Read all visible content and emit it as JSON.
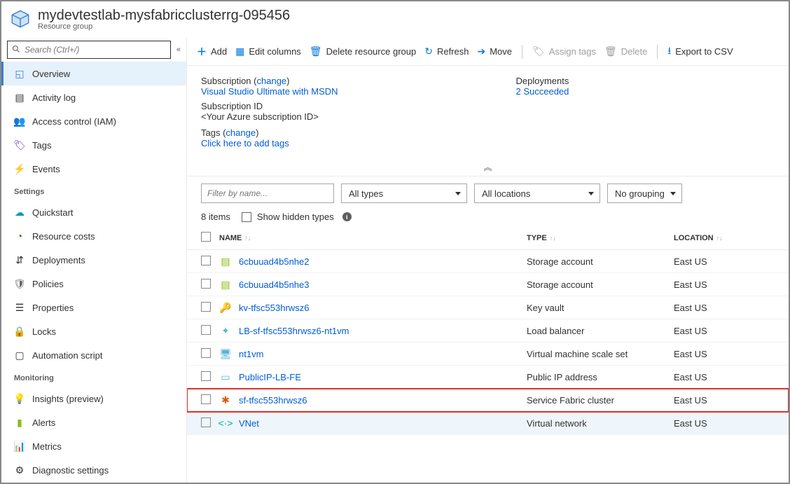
{
  "header": {
    "title": "mydevtestlab-mysfabricclusterrg-095456",
    "subtitle": "Resource group"
  },
  "sidebar": {
    "search_placeholder": "Search (Ctrl+/)",
    "items": [
      {
        "label": "Overview",
        "icon": "cube-icon",
        "color": "#3b7dd8",
        "selected": true
      },
      {
        "label": "Activity log",
        "icon": "log-icon",
        "color": "#323130"
      },
      {
        "label": "Access control (IAM)",
        "icon": "people-icon",
        "color": "#015cda"
      },
      {
        "label": "Tags",
        "icon": "tag-icon",
        "color": "#6b2fbf"
      },
      {
        "label": "Events",
        "icon": "bolt-icon",
        "color": "#faa21b"
      }
    ],
    "sections": [
      {
        "title": "Settings",
        "items": [
          {
            "label": "Quickstart",
            "icon": "rocket-icon",
            "color": "#0099bc"
          },
          {
            "label": "Resource costs",
            "icon": "cost-icon",
            "color": "#107c10"
          },
          {
            "label": "Deployments",
            "icon": "deploy-icon",
            "color": "#323130"
          },
          {
            "label": "Policies",
            "icon": "policy-icon",
            "color": "#666"
          },
          {
            "label": "Properties",
            "icon": "properties-icon",
            "color": "#323130"
          },
          {
            "label": "Locks",
            "icon": "lock-icon",
            "color": "#323130"
          },
          {
            "label": "Automation script",
            "icon": "script-icon",
            "color": "#323130"
          }
        ]
      },
      {
        "title": "Monitoring",
        "items": [
          {
            "label": "Insights (preview)",
            "icon": "bulb-icon",
            "color": "#faa21b"
          },
          {
            "label": "Alerts",
            "icon": "alert-icon",
            "color": "#8cbd18"
          },
          {
            "label": "Metrics",
            "icon": "metrics-icon",
            "color": "#0078d4"
          },
          {
            "label": "Diagnostic settings",
            "icon": "diag-icon",
            "color": "#323130"
          }
        ]
      }
    ]
  },
  "toolbar": {
    "add": "Add",
    "edit_columns": "Edit columns",
    "delete_rg": "Delete resource group",
    "refresh": "Refresh",
    "move": "Move",
    "assign_tags": "Assign tags",
    "delete": "Delete",
    "export": "Export to CSV"
  },
  "essentials": {
    "subscription_label": "Subscription",
    "subscription_change": "change",
    "subscription_value": "Visual Studio Ultimate with MSDN",
    "subscription_id_label": "Subscription ID",
    "subscription_id_value": "<Your Azure subscription ID>",
    "tags_label": "Tags",
    "tags_change": "change",
    "tags_value": "Click here to add tags",
    "deployments_label": "Deployments",
    "deployments_value": "2 Succeeded"
  },
  "filters": {
    "filter_placeholder": "Filter by name...",
    "types": "All types",
    "locations": "All locations",
    "grouping": "No grouping"
  },
  "list_meta": {
    "count": "8 items",
    "hidden": "Show hidden types"
  },
  "columns": {
    "name": "NAME",
    "type": "TYPE",
    "location": "LOCATION"
  },
  "rows": [
    {
      "name": "6cbuuad4b5nhe2",
      "type": "Storage account",
      "location": "East US",
      "icon": "storage-icon",
      "color": "#7fba00"
    },
    {
      "name": "6cbuuad4b5nhe3",
      "type": "Storage account",
      "location": "East US",
      "icon": "storage-icon",
      "color": "#7fba00"
    },
    {
      "name": "kv-tfsc553hrwsz6",
      "type": "Key vault",
      "location": "East US",
      "icon": "key-icon",
      "color": "#faa21b"
    },
    {
      "name": "LB-sf-tfsc553hrwsz6-nt1vm",
      "type": "Load balancer",
      "location": "East US",
      "icon": "lb-icon",
      "color": "#59b4d9"
    },
    {
      "name": "nt1vm",
      "type": "Virtual machine scale set",
      "location": "East US",
      "icon": "vmss-icon",
      "color": "#59b4d9"
    },
    {
      "name": "PublicIP-LB-FE",
      "type": "Public IP address",
      "location": "East US",
      "icon": "ip-icon",
      "color": "#59b4d9"
    },
    {
      "name": "sf-tfsc553hrwsz6",
      "type": "Service Fabric cluster",
      "location": "East US",
      "icon": "sf-icon",
      "color": "#dd5900",
      "highlight": true
    },
    {
      "name": "VNet",
      "type": "Virtual network",
      "location": "East US",
      "icon": "vnet-icon",
      "color": "#00b294",
      "hovered": true
    }
  ],
  "icons": {
    "storage-icon": "▤",
    "key-icon": "🔑",
    "lb-icon": "✦",
    "vmss-icon": "🖥",
    "ip-icon": "▭",
    "sf-icon": "✱",
    "vnet-icon": "<·>"
  }
}
